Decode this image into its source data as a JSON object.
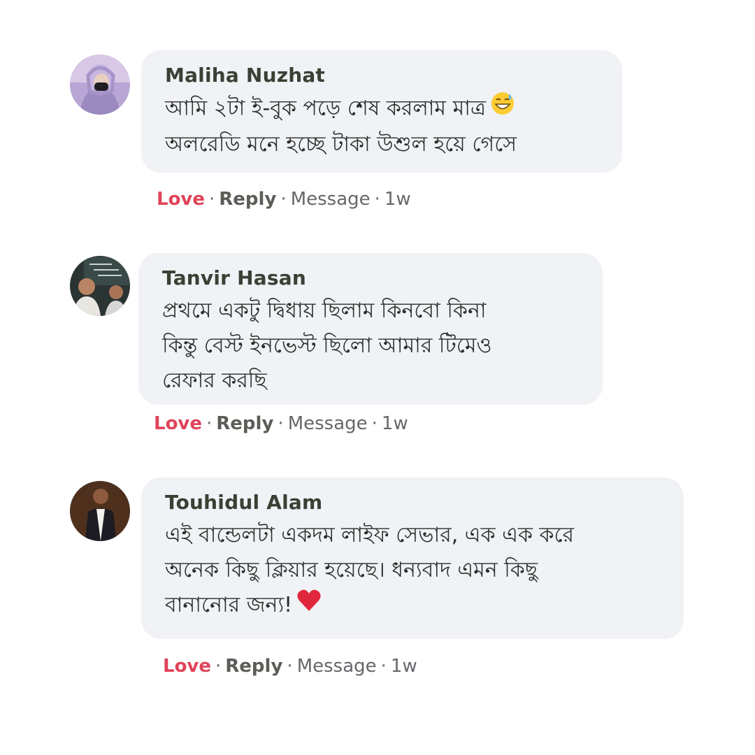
{
  "comments": [
    {
      "author": "Maliha Nuzhat",
      "lines": [
        "আমি ২টা ই-বুক পড়ে শেষ করলাম মাত্র",
        "অলরেডি মনে হচ্ছে টাকা উশুল হয়ে গেসে"
      ],
      "emoji": "grinning-sweat-emoji",
      "actions": {
        "love": "Love",
        "reply": "Reply",
        "message": "Message",
        "time": "1w"
      }
    },
    {
      "author": "Tanvir Hasan",
      "lines": [
        "প্রথমে একটু দ্বিধায় ছিলাম কিনবো কিনা",
        "কিন্তু বেস্ট ইনভেস্ট  ছিলো আমার টিমেও",
        "রেফার করছি"
      ],
      "actions": {
        "love": "Love",
        "reply": "Reply",
        "message": "Message",
        "time": "1w"
      }
    },
    {
      "author": "Touhidul Alam",
      "lines": [
        "এই বান্ডেলটা একদম লাইফ সেভার, এক এক করে",
        "অনেক কিছু ক্লিয়ার হয়েছে। ধন্যবাদ এমন কিছু",
        "বানানোর জন্য!"
      ],
      "emoji": "red-heart-emoji",
      "actions": {
        "love": "Love",
        "reply": "Reply",
        "message": "Message",
        "time": "1w"
      }
    }
  ],
  "separator": "·",
  "colors": {
    "bubble": "#f0f2f5",
    "love": "#e0445a",
    "author": "#3a4034"
  }
}
